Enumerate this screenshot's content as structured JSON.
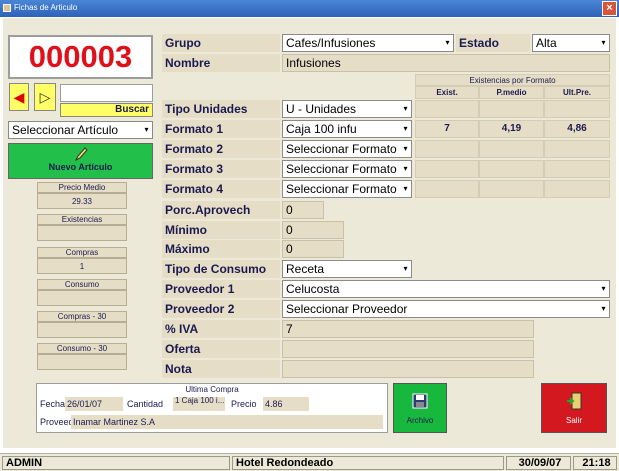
{
  "window": {
    "title": "Fichas de Articulo",
    "close_label": "×"
  },
  "article": {
    "code": "000003"
  },
  "nav": {
    "prev_icon": "◀",
    "next_icon": "▷",
    "search_label": "Buscar",
    "search_value": ""
  },
  "select_article": {
    "value": "Seleccionar Artículo"
  },
  "new_article": {
    "label": "Nuevo Artículo"
  },
  "side_stats": {
    "precio_medio_label": "Precio Medio",
    "precio_medio_value": "29.33",
    "existencias_label": "Existencias",
    "existencias_value": "",
    "compras_label": "Compras",
    "compras_value": "1",
    "consumo_label": "Consumo",
    "consumo_value": "",
    "compras30_label": "Compras - 30",
    "compras30_value": "",
    "consumo30_label": "Consumo - 30",
    "consumo30_value": ""
  },
  "form": {
    "grupo_label": "Grupo",
    "grupo_value": "Cafes/Infusiones",
    "estado_label": "Estado",
    "estado_value": "Alta",
    "nombre_label": "Nombre",
    "nombre_value": "Infusiones",
    "tipo_unidades_label": "Tipo Unidades",
    "tipo_unidades_value": "U - Unidades",
    "formato1_label": "Formato 1",
    "formato1_value": "Caja 100 infu",
    "formato2_label": "Formato 2",
    "formato2_value": "Seleccionar Formato",
    "formato3_label": "Formato 3",
    "formato3_value": "Seleccionar Formato",
    "formato4_label": "Formato 4",
    "formato4_value": "Seleccionar Formato",
    "porc_label": "Porc.Aprovech",
    "porc_value": "0",
    "minimo_label": "Mínimo",
    "minimo_value": "0",
    "maximo_label": "Máximo",
    "maximo_value": "0",
    "tipo_consumo_label": "Tipo de Consumo",
    "tipo_consumo_value": "Receta",
    "proveedor1_label": "Proveedor 1",
    "proveedor1_value": "Celucosta",
    "proveedor2_label": "Proveedor 2",
    "proveedor2_value": "Seleccionar Proveedor",
    "iva_label": "% IVA",
    "iva_value": "7",
    "oferta_label": "Oferta",
    "oferta_value": "",
    "nota_label": "Nota",
    "nota_value": ""
  },
  "existencias": {
    "title": "Existencias por Formato",
    "headers": [
      "Exist.",
      "P.medio",
      "Ult.Pre."
    ],
    "row1": [
      "7",
      "4,19",
      "4,86"
    ]
  },
  "ultima_compra": {
    "title": "Ultima Compra",
    "fecha_label": "Fecha",
    "fecha_value": "26/01/07",
    "cantidad_label": "Cantidad",
    "cantidad_value": "1 Caja 100 i...",
    "precio_label": "Precio",
    "precio_value": "4.86",
    "proveed_label": "Proveed",
    "proveed_value": "Inamar Martinez S.A"
  },
  "buttons": {
    "archive_label": "Archivo",
    "exit_label": "Salir"
  },
  "statusbar": {
    "user": "ADMIN",
    "hotel": "Hotel Redondeado",
    "date": "30/09/07",
    "time": "21:18"
  },
  "colors": {
    "code_red": "#e0101a",
    "new_btn_green": "#22c04a",
    "archive_green": "#18b83e",
    "exit_red": "#d41820"
  }
}
